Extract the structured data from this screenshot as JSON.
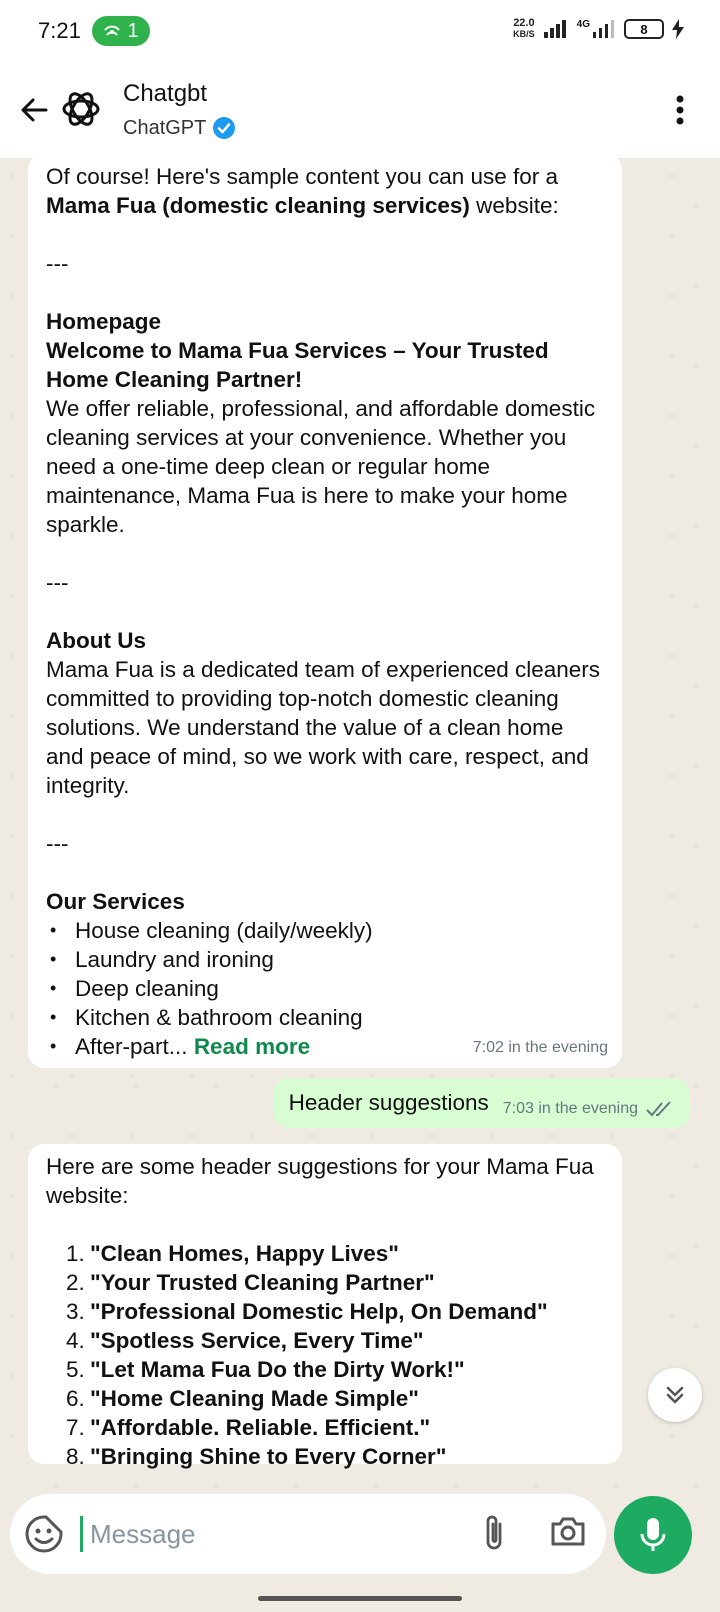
{
  "status_bar": {
    "time": "7:21",
    "hotspot_count": "1",
    "net_speed_value": "22.0",
    "net_speed_unit": "KB/S",
    "network_type": "4G",
    "battery": "8"
  },
  "header": {
    "name": "Chatgbt",
    "subtitle": "ChatGPT"
  },
  "messages": {
    "m1": {
      "intro_a": "Of course! Here's sample content you can use for a ",
      "intro_bold": "Mama Fua (domestic cleaning services)",
      "intro_b": " website:",
      "sep1": "---",
      "homepage_heading": "Homepage",
      "homepage_title": "Welcome to Mama Fua Services – Your Trusted Home Cleaning Partner!",
      "homepage_body": "We offer reliable, professional, and affordable domestic cleaning services at your convenience. Whether you need a one-time deep clean or regular home maintenance, Mama Fua is here to make your home sparkle.",
      "sep2": "---",
      "about_heading": "About Us",
      "about_body": "Mama Fua is a dedicated team of experienced cleaners committed to providing top-notch domestic cleaning solutions. We understand the value of a clean home and peace of mind, so we work with care, respect, and integrity.",
      "sep3": "---",
      "services_heading": "Our Services",
      "services": [
        "House cleaning (daily/weekly)",
        "Laundry and ironing",
        "Deep cleaning",
        "Kitchen & bathroom cleaning",
        "After-part..."
      ],
      "read_more": "Read more",
      "time": "7:02 in the evening"
    },
    "m2": {
      "text": "Header suggestions",
      "time": "7:03 in the evening"
    },
    "m3": {
      "intro": "Here are some header suggestions for your Mama Fua website:",
      "items": [
        {
          "num": "1.",
          "text": "\"Clean Homes, Happy Lives\""
        },
        {
          "num": "2.",
          "text": "\"Your Trusted Cleaning Partner\""
        },
        {
          "num": "3.",
          "text": "\"Professional Domestic Help, On Demand\""
        },
        {
          "num": "4.",
          "text": "\"Spotless Service, Every Time\""
        },
        {
          "num": "5.",
          "text": "\"Let Mama Fua Do the Dirty Work!\""
        },
        {
          "num": "6.",
          "text": "\"Home Cleaning Made Simple\""
        },
        {
          "num": "7.",
          "text": "\"Affordable. Reliable. Efficient.\""
        },
        {
          "num": "8.",
          "text": "\"Bringing Shine to Every Corner\""
        }
      ]
    }
  },
  "composer": {
    "placeholder": "Message"
  },
  "colors": {
    "accent": "#1daa61",
    "outgoing_bubble": "#d9fdd3",
    "chat_bg": "#efeae2"
  }
}
